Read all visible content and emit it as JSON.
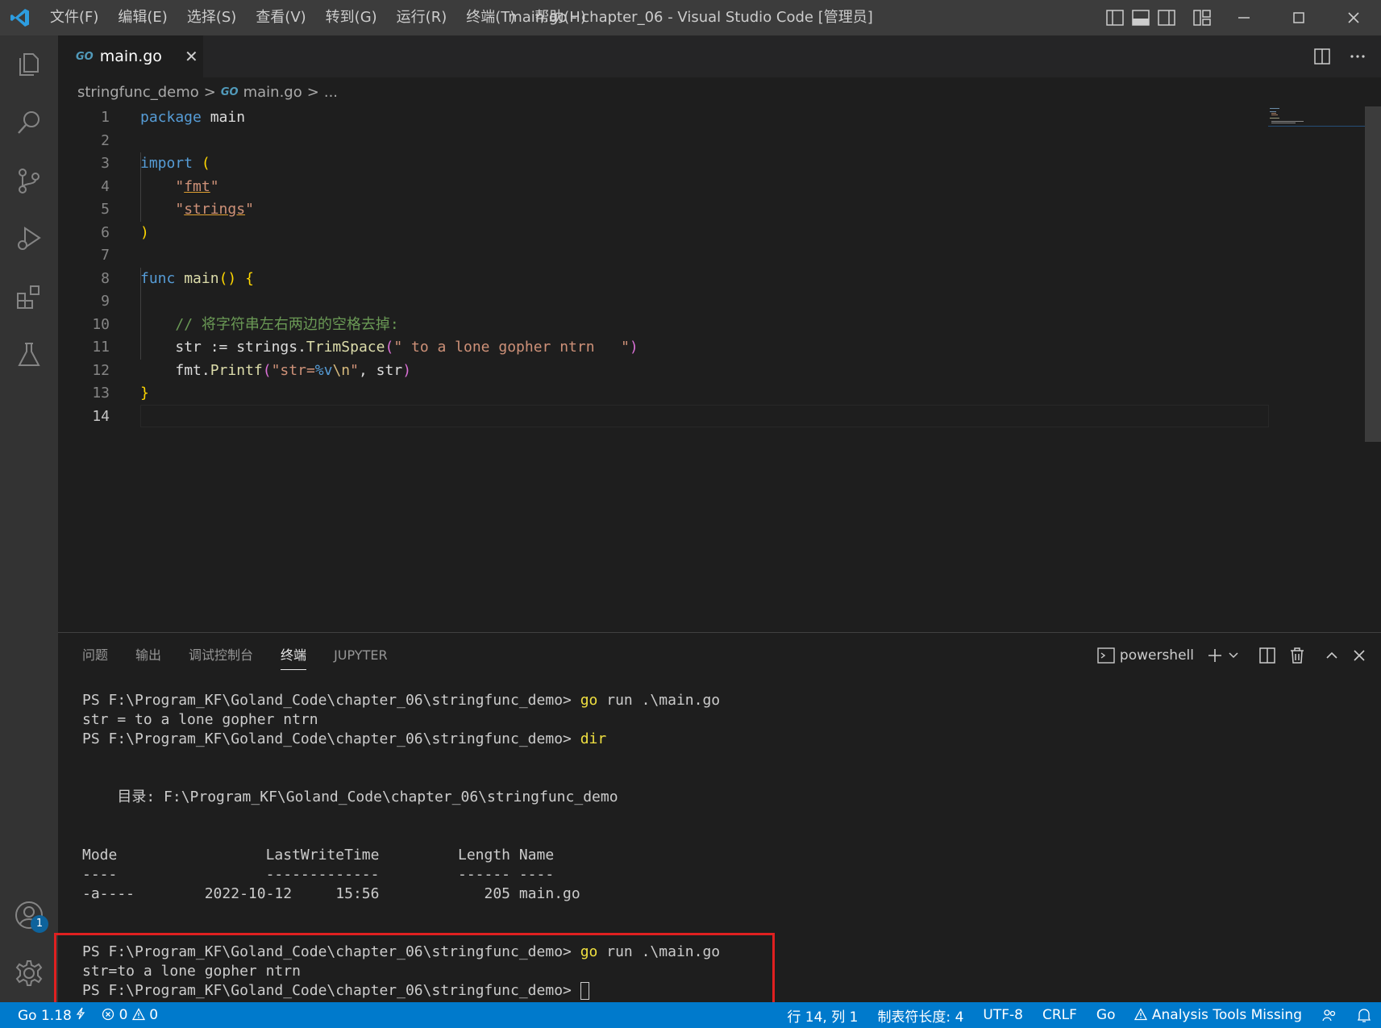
{
  "window": {
    "title": "main.go - chapter_06 - Visual Studio Code [管理员]",
    "menu": [
      "文件(F)",
      "编辑(E)",
      "选择(S)",
      "查看(V)",
      "转到(G)",
      "运行(R)",
      "终端(T)",
      "帮助(H)"
    ]
  },
  "colors": {
    "accent": "#007acc",
    "keyword": "#569cd6",
    "string": "#ce9178",
    "comment": "#6a9955",
    "highlight_box": "#e02020"
  },
  "activity_bar": {
    "accounts_badge": "1",
    "icons": [
      "files-icon",
      "search-icon",
      "source-control-icon",
      "run-debug-icon",
      "extensions-icon",
      "testing-icon",
      "account-icon",
      "gear-icon"
    ]
  },
  "tabs": [
    {
      "icon": "GO",
      "label": "main.go",
      "close": "✕"
    }
  ],
  "breadcrumb": {
    "folder": "stringfunc_demo",
    "sep": ">",
    "file_icon": "GO",
    "file": "main.go",
    "more": "..."
  },
  "editor": {
    "line_numbers": [
      "1",
      "2",
      "3",
      "4",
      "5",
      "6",
      "7",
      "8",
      "9",
      "10",
      "11",
      "12",
      "13",
      "14"
    ],
    "active_line": "14",
    "lines": {
      "l1_kw": "package",
      "l1_id": "main",
      "l3_kw": "import",
      "l3_p": "(",
      "l4_q1": "\"",
      "l4_s": "fmt",
      "l4_q2": "\"",
      "l5_q1": "\"",
      "l5_s": "strings",
      "l5_q2": "\"",
      "l6_p": ")",
      "l8_kw": "func",
      "l8_fn": "main",
      "l8_p1": "()",
      "l8_p2": "{",
      "l10_cm": "// 将字符串左右两边的空格去掉:",
      "l11_a": "str := strings.",
      "l11_fn": "TrimSpace",
      "l11_p1": "(",
      "l11_s": "\" to a lone gopher ntrn   \"",
      "l11_p2": ")",
      "l12_a": "fmt.",
      "l12_fn": "Printf",
      "l12_p1": "(",
      "l12_s1": "\"str=",
      "l12_e1": "%v",
      "l12_e2": "\\n",
      "l12_s2": "\"",
      "l12_b": ", str",
      "l12_p2": ")",
      "l13_p": "}"
    }
  },
  "panel": {
    "tabs": [
      "问题",
      "输出",
      "调试控制台",
      "终端",
      "JUPYTER"
    ],
    "active_tab": "终端",
    "shell": "powershell",
    "terminal": {
      "l1_prompt": "PS F:\\Program_KF\\Goland_Code\\chapter_06\\stringfunc_demo> ",
      "l1_cmd": "go",
      "l1_args": " run .\\main.go",
      "l2": "str = to a lone gopher ntrn",
      "l3_prompt": "PS F:\\Program_KF\\Goland_Code\\chapter_06\\stringfunc_demo> ",
      "l3_cmd": "dir",
      "l4": "    目录: F:\\Program_KF\\Goland_Code\\chapter_06\\stringfunc_demo",
      "l5": "Mode                 LastWriteTime         Length Name",
      "l6": "----                 -------------         ------ ----",
      "l7": "-a----        2022-10-12     15:56            205 main.go",
      "l8_prompt": "PS F:\\Program_KF\\Goland_Code\\chapter_06\\stringfunc_demo> ",
      "l8_cmd": "go",
      "l8_args": " run .\\main.go",
      "l9": "str=to a lone gopher ntrn",
      "l10_prompt": "PS F:\\Program_KF\\Goland_Code\\chapter_06\\stringfunc_demo> "
    }
  },
  "statusbar": {
    "go_version": "Go 1.18",
    "errors": "0",
    "warnings": "0",
    "position": "行 14, 列 1",
    "tab_size": "制表符长度: 4",
    "encoding": "UTF-8",
    "eol": "CRLF",
    "language": "Go",
    "analysis": "Analysis Tools Missing"
  }
}
